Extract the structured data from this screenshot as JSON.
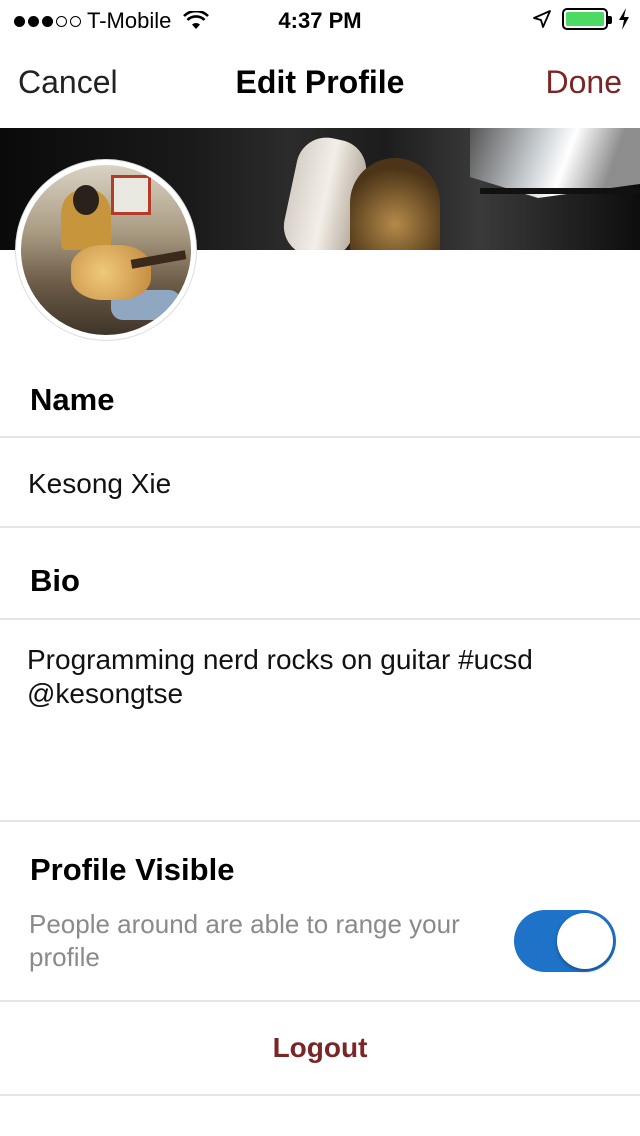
{
  "status_bar": {
    "carrier": "T-Mobile",
    "time": "4:37 PM",
    "signal_bars_filled": 3,
    "signal_bars_total": 5,
    "battery_level": 1.0
  },
  "nav": {
    "cancel_label": "Cancel",
    "title": "Edit Profile",
    "done_label": "Done"
  },
  "profile": {
    "name_label": "Name",
    "name_value": "Kesong Xie",
    "bio_label": "Bio",
    "bio_value": "Programming nerd rocks on guitar #ucsd\n@kesongtse",
    "visible_label": "Profile Visible",
    "visible_description": "People around are able to range your profile",
    "visible_enabled": true
  },
  "actions": {
    "logout_label": "Logout"
  },
  "colors": {
    "accent": "#7a2626",
    "toggle_on": "#1e73c8",
    "secondary_text": "#8a8a8a"
  }
}
